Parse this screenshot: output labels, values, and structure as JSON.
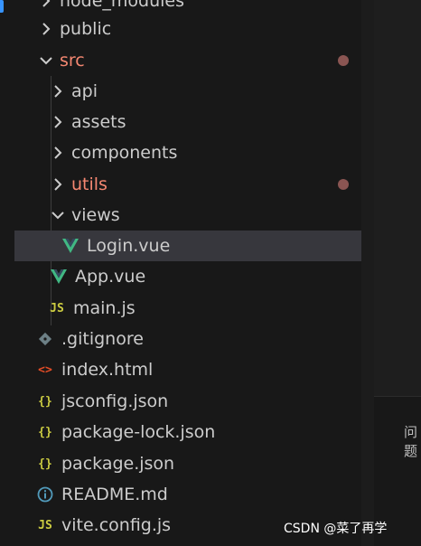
{
  "explorer": {
    "items": [
      {
        "label": "node_modules",
        "kind": "folder-collapsed",
        "icon": "chevron-right-icon",
        "color": "#cccccc"
      },
      {
        "label": "public",
        "kind": "folder-collapsed",
        "icon": "chevron-right-icon",
        "color": "#cccccc"
      },
      {
        "label": "src",
        "kind": "folder-expanded",
        "icon": "chevron-down-icon",
        "color": "#f48771",
        "modified": true
      },
      {
        "label": "api",
        "kind": "folder-collapsed",
        "icon": "chevron-right-icon",
        "color": "#cccccc"
      },
      {
        "label": "assets",
        "kind": "folder-collapsed",
        "icon": "chevron-right-icon",
        "color": "#cccccc"
      },
      {
        "label": "components",
        "kind": "folder-collapsed",
        "icon": "chevron-right-icon",
        "color": "#cccccc"
      },
      {
        "label": "utils",
        "kind": "folder-collapsed",
        "icon": "chevron-right-icon",
        "color": "#f48771",
        "modified": true
      },
      {
        "label": "views",
        "kind": "folder-expanded",
        "icon": "chevron-down-icon",
        "color": "#cccccc"
      },
      {
        "label": "Login.vue",
        "kind": "file",
        "icon": "vue-icon",
        "color": "#cccccc",
        "selected": true
      },
      {
        "label": "App.vue",
        "kind": "file",
        "icon": "vue-icon",
        "color": "#cccccc"
      },
      {
        "label": "main.js",
        "kind": "file",
        "icon": "js-icon",
        "color": "#cccccc"
      },
      {
        "label": ".gitignore",
        "kind": "file",
        "icon": "git-icon",
        "color": "#cccccc"
      },
      {
        "label": "index.html",
        "kind": "file",
        "icon": "html-icon",
        "color": "#cccccc"
      },
      {
        "label": "jsconfig.json",
        "kind": "file",
        "icon": "json-icon",
        "color": "#cccccc"
      },
      {
        "label": "package-lock.json",
        "kind": "file",
        "icon": "json-icon",
        "color": "#cccccc"
      },
      {
        "label": "package.json",
        "kind": "file",
        "icon": "json-icon",
        "color": "#cccccc"
      },
      {
        "label": "README.md",
        "kind": "file",
        "icon": "info-icon",
        "color": "#cccccc"
      },
      {
        "label": "vite.config.js",
        "kind": "file",
        "icon": "js-icon",
        "color": "#cccccc"
      }
    ],
    "icon_glyphs": {
      "js": "JS",
      "json": "{}",
      "html": "<>",
      "info": "i"
    }
  },
  "panel": {
    "label": "问题"
  },
  "watermark": "CSDN @菜了再学",
  "colors": {
    "modified_text": "#f48771",
    "modified_dot": "#8a5552",
    "vue": "#41b883",
    "js": "#cbcb41",
    "json": "#cbcb41",
    "html": "#e44d26",
    "git": "#6d8086",
    "info": "#519aba",
    "selected_bg": "#37373d"
  }
}
